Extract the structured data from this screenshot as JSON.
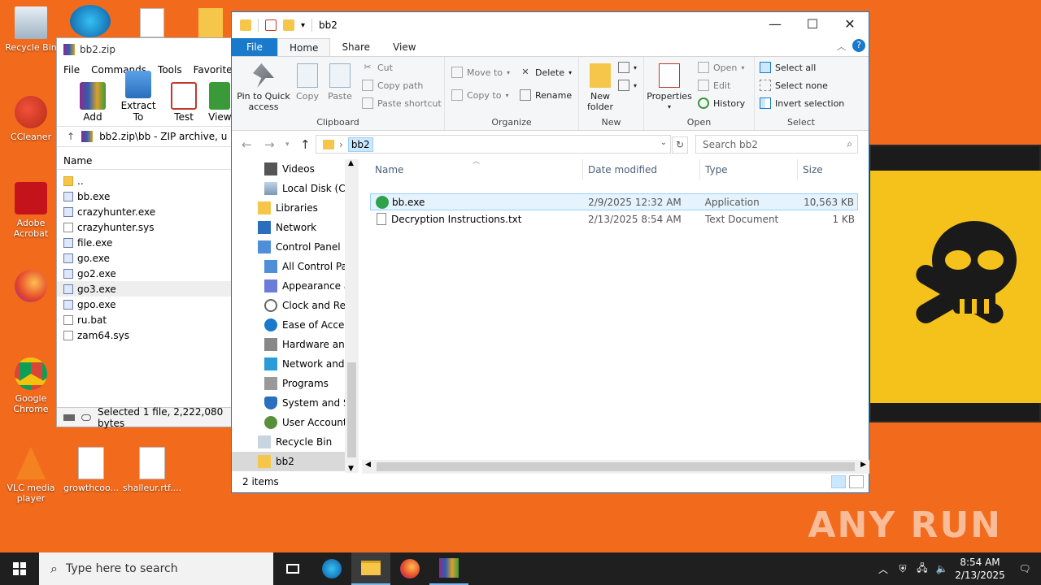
{
  "desktop": {
    "icons": [
      {
        "label": "Recycle Bin"
      },
      {
        "label": "CCleaner"
      },
      {
        "label": "Adobe Acrobat"
      },
      {
        "label": "Google Chrome"
      },
      {
        "label": "VLC media player"
      },
      {
        "label": "growthcoo..."
      },
      {
        "label": "shalleur.rtf...."
      }
    ],
    "watermark": "ANY RUN"
  },
  "winrar": {
    "title": "bb2.zip",
    "menu": [
      "File",
      "Commands",
      "Tools",
      "Favorites"
    ],
    "toolbar": [
      "Add",
      "Extract To",
      "Test",
      "View"
    ],
    "path": "bb2.zip\\bb - ZIP archive, u",
    "column": "Name",
    "files": [
      "..",
      "bb.exe",
      "crazyhunter.exe",
      "crazyhunter.sys",
      "file.exe",
      "go.exe",
      "go2.exe",
      "go3.exe",
      "gpo.exe",
      "ru.bat",
      "zam64.sys"
    ],
    "status": "Selected 1 file, 2,222,080 bytes"
  },
  "explorer": {
    "title": "bb2",
    "tabs": {
      "file": "File",
      "home": "Home",
      "share": "Share",
      "view": "View"
    },
    "ribbon": {
      "clipboard": {
        "label": "Clipboard",
        "pin": "Pin to Quick access",
        "copy": "Copy",
        "paste": "Paste",
        "cut": "Cut",
        "copy_path": "Copy path",
        "paste_shortcut": "Paste shortcut"
      },
      "organize": {
        "label": "Organize",
        "move_to": "Move to",
        "copy_to": "Copy to",
        "delete": "Delete",
        "rename": "Rename"
      },
      "new": {
        "label": "New",
        "new_folder": "New folder"
      },
      "open": {
        "label": "Open",
        "properties": "Properties",
        "open": "Open",
        "edit": "Edit",
        "history": "History"
      },
      "select": {
        "label": "Select",
        "select_all": "Select all",
        "select_none": "Select none",
        "invert": "Invert selection"
      }
    },
    "address": {
      "crumb": "bb2",
      "search_placeholder": "Search bb2"
    },
    "nav": [
      "Videos",
      "Local Disk (C:)",
      "Libraries",
      "Network",
      "Control Panel",
      "All Control Par",
      "Appearance an",
      "Clock and Regi",
      "Ease of Access",
      "Hardware and",
      "Network and Ir",
      "Programs",
      "System and Sec",
      "User Accounts",
      "Recycle Bin",
      "bb2"
    ],
    "columns": {
      "name": "Name",
      "date": "Date modified",
      "type": "Type",
      "size": "Size"
    },
    "files": [
      {
        "name": "bb.exe",
        "date": "2/9/2025 12:32 AM",
        "type": "Application",
        "size": "10,563 KB"
      },
      {
        "name": "Decryption Instructions.txt",
        "date": "2/13/2025 8:54 AM",
        "type": "Text Document",
        "size": "1 KB"
      }
    ],
    "status": "2 items"
  },
  "taskbar": {
    "search_placeholder": "Type here to search",
    "time": "8:54 AM",
    "date": "2/13/2025"
  },
  "colors": {
    "accent": "#1979ca",
    "desktop": "#f26b1d",
    "selection": "#cce8ff"
  }
}
